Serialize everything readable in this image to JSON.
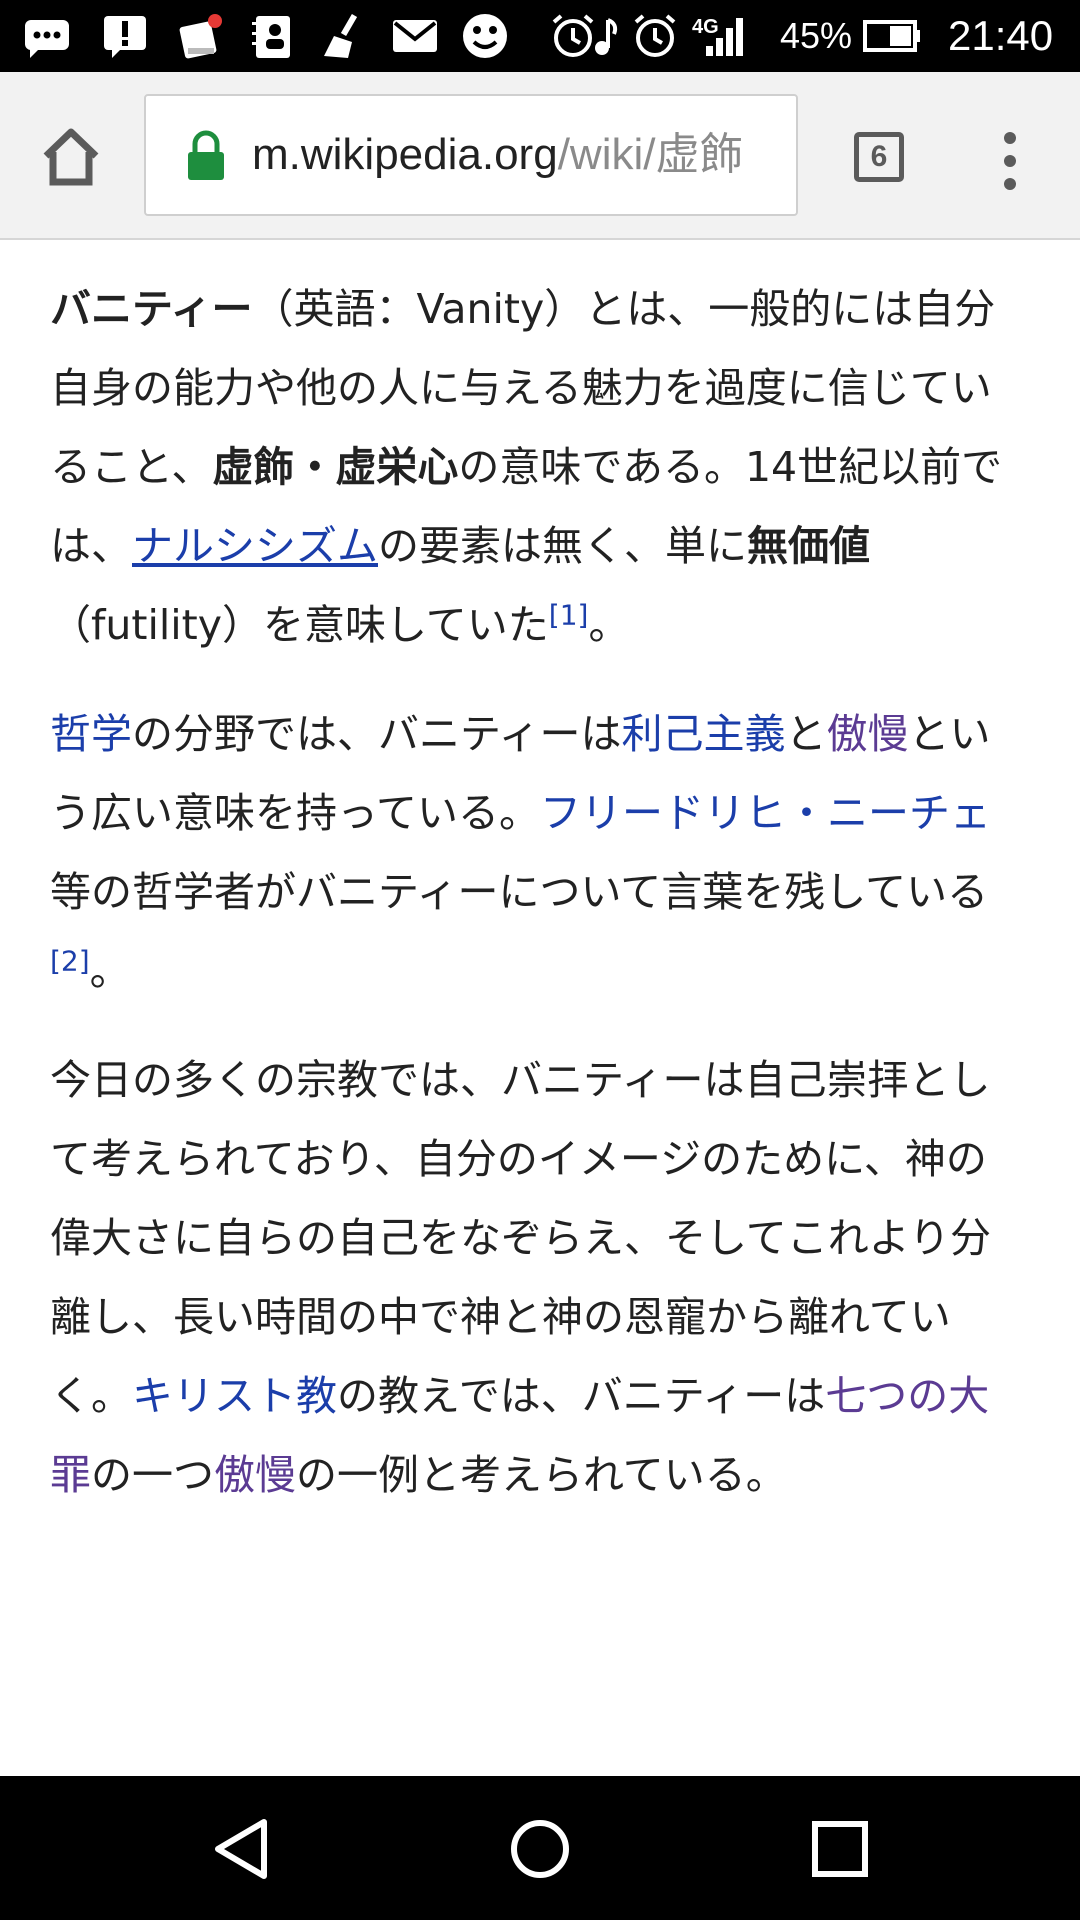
{
  "status_bar": {
    "network": "4G",
    "battery": "45%",
    "time": "21:40",
    "icons": [
      "chat-icon",
      "alert-icon",
      "clipboard-icon",
      "contacts-icon",
      "broom-icon",
      "mail-icon",
      "face-icon",
      "alarm-icon",
      "music-icon",
      "alarm-icon",
      "signal-icon",
      "battery-icon"
    ]
  },
  "browser": {
    "url_host": "m.wikipedia.org",
    "url_path": "/wiki/虚飾",
    "tab_count": "6"
  },
  "article": {
    "p1": {
      "term": "バニティー",
      "t1": "（英語：Vanity）とは、一般的には自分自身の能力や他の人に与える魅力を過度に信じていること、",
      "b1": "虚飾・虚栄心",
      "t2": "の意味である。14世紀以前では、",
      "link1": "ナルシシズム",
      "t3": "の要素は無く、単に",
      "b2": "無価値",
      "t4": "（futility）を意味していた",
      "ref": "[1]",
      "end": "。"
    },
    "p2": {
      "link1": "哲学",
      "t1": "の分野では、バニティーは",
      "link2": "利己主義",
      "t2": "と",
      "link3": "傲慢",
      "t3": "という広い意味を持っている。",
      "link4": "フリードリヒ・ニーチェ",
      "t4": "等の哲学者がバニティーについて言葉を残している",
      "ref": "[2]",
      "end": "。"
    },
    "p3": {
      "t1": "今日の多くの宗教では、バニティーは自己崇拝として考えられており、自分のイメージのために、神の偉大さに自らの自己をなぞらえ、そしてこれより分離し、長い時間の中で神と神の恩寵から離れていく。",
      "link1": "キリスト教",
      "t2": "の教えでは、バニティーは",
      "link2": "七つの大罪",
      "t3": "の一つ",
      "link3": "傲慢",
      "t4": "の一例と考えられている。"
    }
  },
  "colors": {
    "link": "#1b3eaa",
    "visited_link": "#5b3b93",
    "secure_lock": "#1e8e3e",
    "toolbar_bg": "#f2f2f2"
  }
}
